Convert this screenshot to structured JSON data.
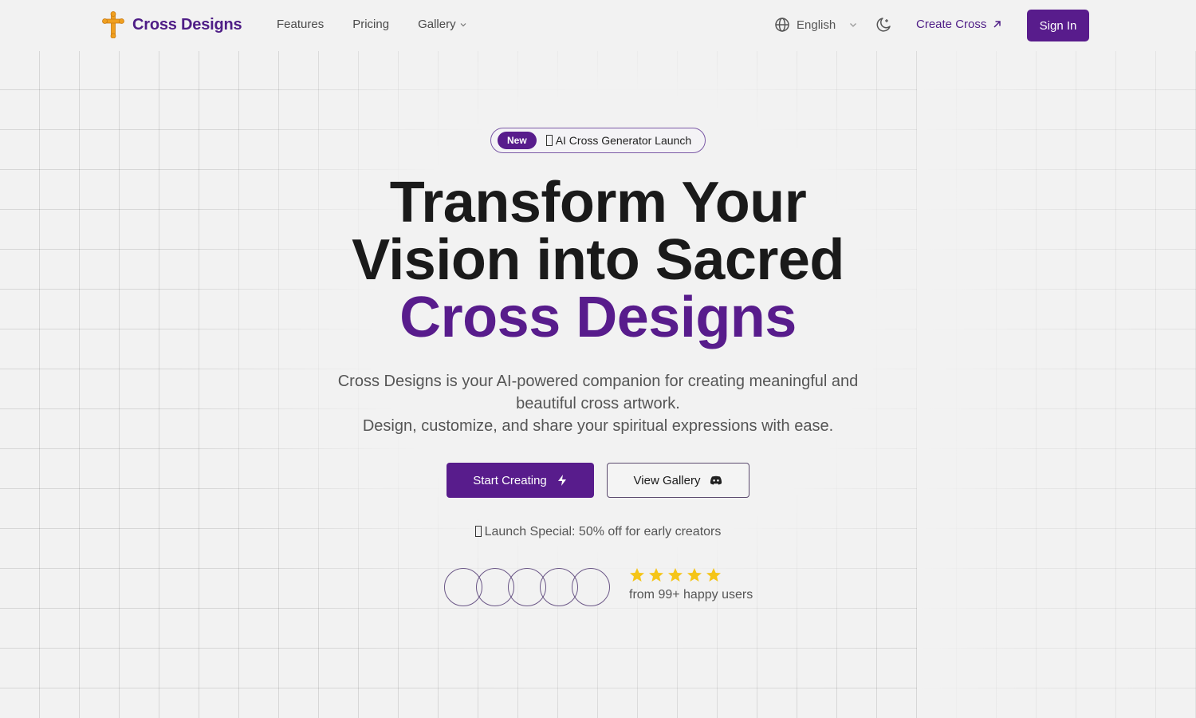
{
  "header": {
    "brand": "Cross Designs",
    "nav": [
      {
        "label": "Features"
      },
      {
        "label": "Pricing"
      },
      {
        "label": "Gallery",
        "has_dropdown": true
      }
    ],
    "language": "English",
    "create_link": "Create Cross",
    "sign_in": "Sign In"
  },
  "hero": {
    "badge": {
      "tag": "New",
      "text": "AI Cross Generator Launch"
    },
    "headline_line1": "Transform Your",
    "headline_line2": "Vision into Sacred",
    "headline_accent": "Cross Designs",
    "subtitle_line1": "Cross Designs is your AI-powered companion for creating meaningful and beautiful cross artwork.",
    "subtitle_line2": "Design, customize, and share your spiritual expressions with ease.",
    "primary_button": "Start Creating",
    "secondary_button": "View Gallery",
    "promo": "Launch Special: 50% off for early creators",
    "rating": {
      "stars": 5,
      "max_stars": 5,
      "text": "from 99+ happy users"
    },
    "avatar_count": 5
  },
  "colors": {
    "brand": "#581c8c",
    "background": "#f2f2f2",
    "star": "#f5c518",
    "logo_cross": "#f0a020"
  },
  "icons": {
    "logo": "cross-icon",
    "language": "globe-icon",
    "theme": "moon-stars-icon",
    "create": "arrow-up-right-icon",
    "primary_button": "lightning-icon",
    "secondary_button": "discord-icon"
  }
}
